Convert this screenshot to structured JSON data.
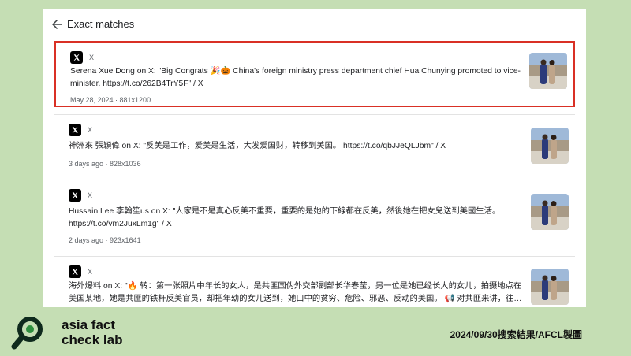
{
  "header": {
    "title": "Exact matches"
  },
  "results": [
    {
      "source": "X",
      "author": "Serena Xue Dong",
      "title": "Serena Xue Dong on X: \"Big Congrats 🎉🎃 China's foreign ministry press department chief Hua Chunying promoted to vice-minister. https://t.co/262B4TrY5F\" / X",
      "meta": "May 28, 2024 · 881x1200"
    },
    {
      "source": "X",
      "title": "神洲來 張穎偉 on X: \"反美是工作，爱美是生活，大发爱国财，转移到美国。 https://t.co/qbJJeQLJbm\" / X",
      "meta": "3 days ago · 828x1036"
    },
    {
      "source": "X",
      "title": "Hussain Lee 李翰笙us on X: \"人家是不是真心反美不重要，重要的是她的下線都在反美，然後她在把女兒送到美國生活。 https://t.co/vm2JuxLm1g\" / X",
      "meta": "2 days ago · 923x1641"
    },
    {
      "source": "X",
      "title": "海外爆料 on X: \"🔥 转：第一张照片中年长的女人，是共匪国伪外交部副部长华春莹，另一位是她已经长大的女儿，拍摄地点在美国某地，她是共匪的铁杆反美官员，却把年幼的女儿送到，她口中的贫穷、危险、邪恶、反动的美国。 📢 对共匪来讲，往…",
      "meta": ""
    }
  ],
  "footer": {
    "logo_line1": "asia fact",
    "logo_line2": "check lab",
    "caption": "2024/09/30搜索結果/AFCL製圖"
  },
  "colors": {
    "background": "#c5deb4",
    "highlight": "#d93025",
    "logo_dark": "#0f2a1d",
    "logo_green": "#2f8f3f"
  }
}
